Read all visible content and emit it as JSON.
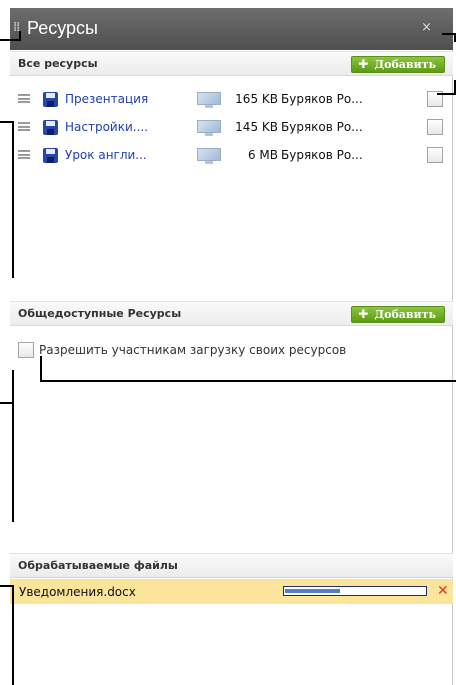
{
  "window": {
    "title": "Ресурсы",
    "close_glyph": "×"
  },
  "all_resources": {
    "heading": "Все ресурсы",
    "add_label": "Добавить",
    "add_glyph": "✚",
    "items": [
      {
        "name": "Презентация",
        "size": "165 KB",
        "owner": "Буряков Ро...",
        "checked": false,
        "type_icon": "floppy-disk-icon",
        "preview_icon": "monitor-icon"
      },
      {
        "name": "Настройки....",
        "size": "145 KB",
        "owner": "Буряков Ро...",
        "checked": false,
        "type_icon": "floppy-disk-icon",
        "preview_icon": "monitor-icon"
      },
      {
        "name": "Урок англи...",
        "size": "6 MB",
        "owner": "Буряков Ро...",
        "checked": false,
        "type_icon": "floppy-disk-icon",
        "preview_icon": "monitor-icon"
      }
    ]
  },
  "public_resources": {
    "heading": "Общедоступные Ресурсы",
    "add_label": "Добавить",
    "add_glyph": "✚",
    "allow_upload_label": "Разрешить участникам загрузку своих ресурсов",
    "allow_upload_checked": false
  },
  "processing": {
    "heading": "Обрабатываемые файлы",
    "files": [
      {
        "name": "Уведомления.docx",
        "progress": 0.4,
        "cancel_glyph": "✕"
      }
    ]
  },
  "colors": {
    "accent_green": "#6fae26",
    "link_blue": "#1f3fb0",
    "highlight_yellow": "#fbe59a",
    "cancel_red": "#e4332c"
  }
}
